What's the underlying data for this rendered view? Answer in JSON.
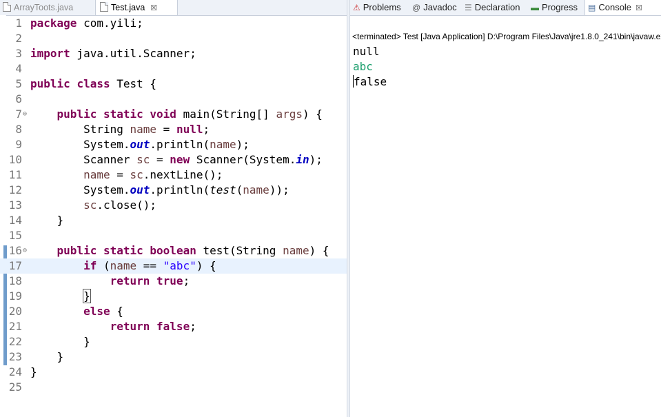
{
  "editor": {
    "tabs": [
      {
        "label": "ArrayToots.java",
        "active": false
      },
      {
        "label": "Test.java",
        "active": true
      }
    ],
    "close_glyph": "☒",
    "lines": [
      {
        "n": "1"
      },
      {
        "n": "2"
      },
      {
        "n": "3"
      },
      {
        "n": "4"
      },
      {
        "n": "5"
      },
      {
        "n": "6"
      },
      {
        "n": "7"
      },
      {
        "n": "8"
      },
      {
        "n": "9"
      },
      {
        "n": "10"
      },
      {
        "n": "11"
      },
      {
        "n": "12"
      },
      {
        "n": "13"
      },
      {
        "n": "14"
      },
      {
        "n": "15"
      },
      {
        "n": "16"
      },
      {
        "n": "17"
      },
      {
        "n": "18"
      },
      {
        "n": "19"
      },
      {
        "n": "20"
      },
      {
        "n": "21"
      },
      {
        "n": "22"
      },
      {
        "n": "23"
      },
      {
        "n": "24"
      },
      {
        "n": "25"
      }
    ],
    "code": {
      "l1": [
        "package",
        " com.yili;"
      ],
      "l3": [
        "import",
        " java.util.Scanner;"
      ],
      "l5": [
        "public",
        " ",
        "class",
        " Test {"
      ],
      "l7": [
        "    ",
        "public",
        " ",
        "static",
        " ",
        "void",
        " main(String[] ",
        "args",
        ") {"
      ],
      "l8": [
        "        String ",
        "name",
        " = ",
        "null",
        ";"
      ],
      "l9": [
        "        System.",
        "out",
        ".println(",
        "name",
        ");"
      ],
      "l10": [
        "        Scanner ",
        "sc",
        " = ",
        "new",
        " Scanner(System.",
        "in",
        ");"
      ],
      "l11": [
        "        ",
        "name",
        " = ",
        "sc",
        ".nextLine();"
      ],
      "l12": [
        "        System.",
        "out",
        ".println(",
        "test",
        "(",
        "name",
        "));"
      ],
      "l13": [
        "        ",
        "sc",
        ".close();"
      ],
      "l14": [
        "    }"
      ],
      "l16": [
        "    ",
        "public",
        " ",
        "static",
        " ",
        "boolean",
        " test(String ",
        "name",
        ") {"
      ],
      "l17": [
        "        ",
        "if",
        " (",
        "name",
        " == ",
        "\"abc\"",
        ") {"
      ],
      "l18": [
        "            ",
        "return",
        " ",
        "true",
        ";"
      ],
      "l19": [
        "        ",
        "}"
      ],
      "l20": [
        "        ",
        "else",
        " {"
      ],
      "l21": [
        "            ",
        "return",
        " ",
        "false",
        ";"
      ],
      "l22": [
        "        }"
      ],
      "l23": [
        "    }"
      ],
      "l24": [
        "}"
      ]
    },
    "fold_glyph": "⊖"
  },
  "console": {
    "tabs": [
      {
        "label": "Problems",
        "icon": "problems-icon",
        "glyph": "⚠"
      },
      {
        "label": "Javadoc",
        "icon": "javadoc-icon",
        "glyph": "@"
      },
      {
        "label": "Declaration",
        "icon": "declaration-icon",
        "glyph": "☰"
      },
      {
        "label": "Progress",
        "icon": "progress-icon",
        "glyph": "▬"
      },
      {
        "label": "Console",
        "icon": "console-icon",
        "glyph": "▤",
        "active": true
      }
    ],
    "close_glyph": "☒",
    "status": "<terminated> Test [Java Application] D:\\Program Files\\Java\\jre1.8.0_241\\bin\\javaw.exe",
    "output": [
      {
        "text": "null",
        "type": "stdout"
      },
      {
        "text": "abc",
        "type": "stdin"
      },
      {
        "text": "false",
        "type": "stdout"
      }
    ]
  },
  "colors": {
    "keyword": "#7f0055",
    "field": "#0000c0",
    "string": "#2a00ff",
    "local_var": "#6a3e3e",
    "console_input": "#1a9e6c",
    "current_line": "#e8f2fe"
  }
}
